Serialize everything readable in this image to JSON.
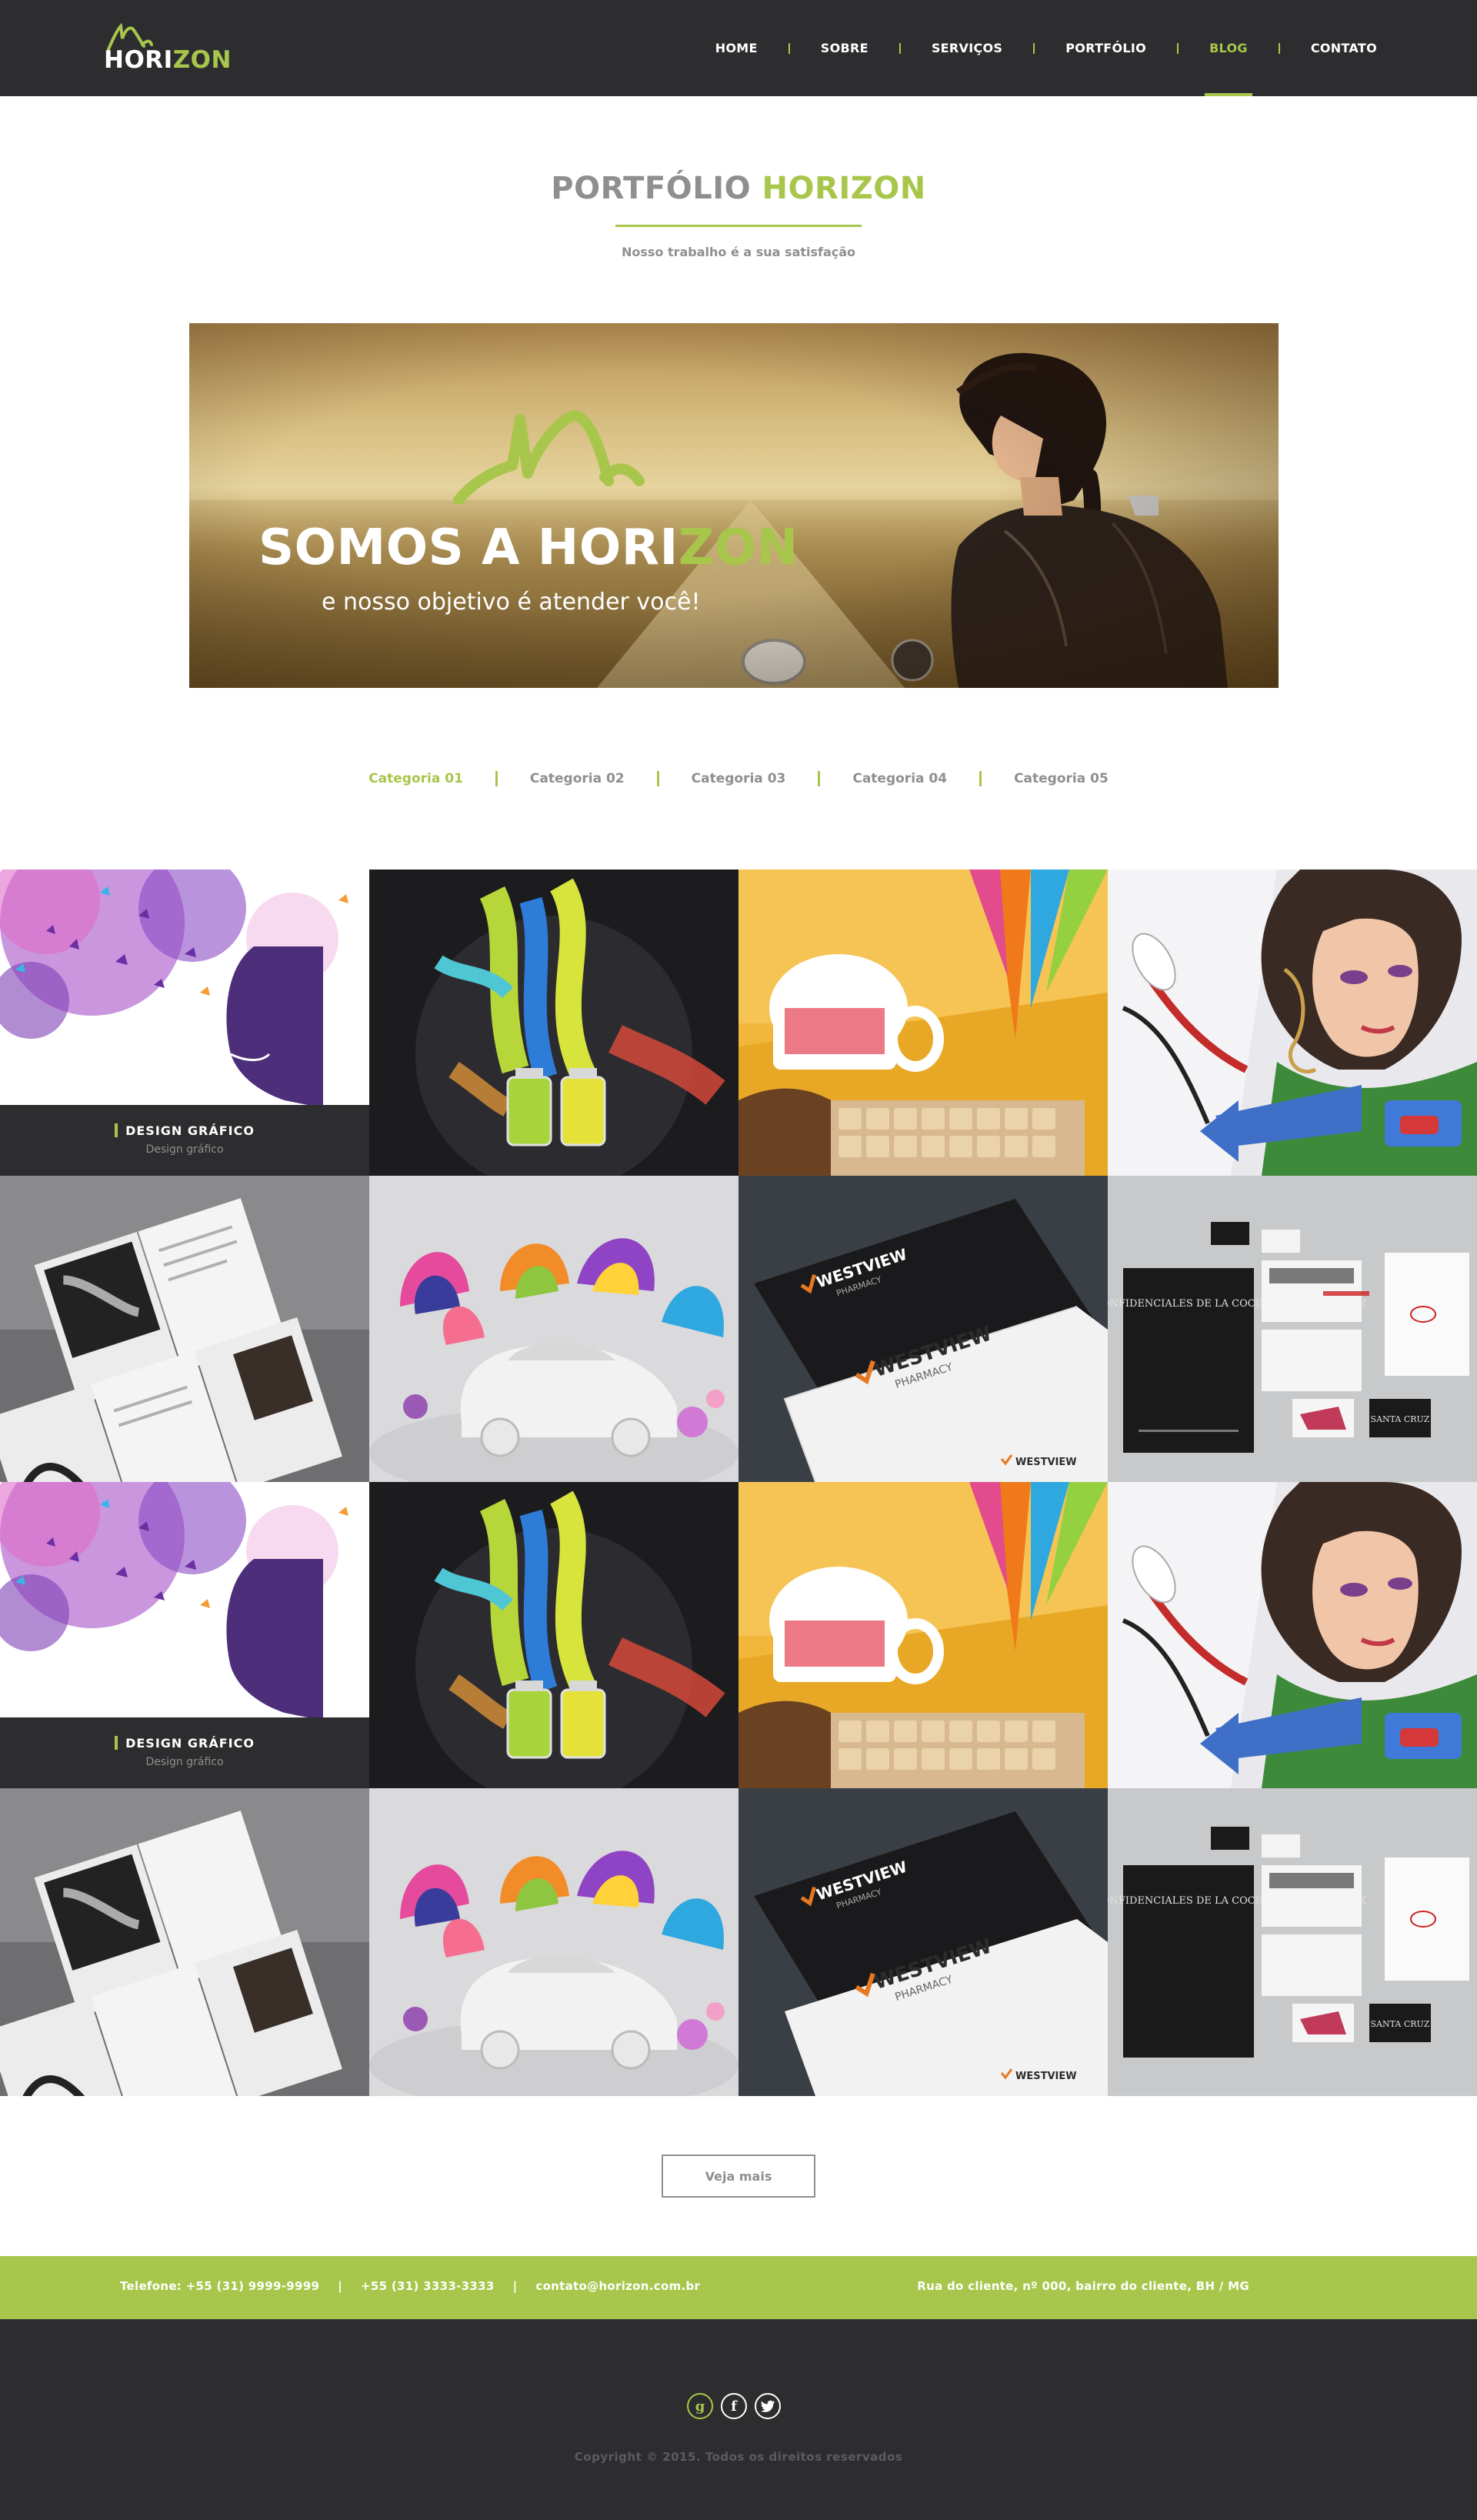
{
  "brand": {
    "logo_part1": "HORI",
    "logo_part2": "ZON"
  },
  "nav": {
    "items": [
      {
        "label": "HOME"
      },
      {
        "label": "SOBRE"
      },
      {
        "label": "SERVIÇOS"
      },
      {
        "label": "PORTFÓLIO"
      },
      {
        "label": "BLOG",
        "active": true
      },
      {
        "label": "CONTATO"
      }
    ]
  },
  "page": {
    "title_part1": "PORTFÓLIO",
    "title_part2": "HORIZON",
    "subtitle": "Nosso trabalho é a sua satisfação"
  },
  "hero": {
    "title_part1": "SOMOS A HORI",
    "title_part2": "ZON",
    "subtitle": "e nosso objetivo é atender você!"
  },
  "categories": [
    {
      "label": "Categoria 01",
      "active": true
    },
    {
      "label": "Categoria 02"
    },
    {
      "label": "Categoria 03"
    },
    {
      "label": "Categoria 04"
    },
    {
      "label": "Categoria 05"
    }
  ],
  "portfolio": {
    "overlay_title": "DESIGN GRÁFICO",
    "overlay_subtitle": "Design gráfico",
    "westview_1": "WESTVIEW",
    "westview_2": "PHARMACY",
    "documents_text": "DOCUMENTOS CONFIDENCIALES DE LA COCINA DE SANTA CRUZ",
    "santa_cruz": "SANTA CRUZ"
  },
  "more_button": "Veja mais",
  "contact": {
    "phone1": "Telefone: +55 (31) 9999-9999",
    "phone2": "+55 (31) 3333-3333",
    "email": "contato@horizon.com.br",
    "separator": "|",
    "address": "Rua do cliente, nº 000, bairro do cliente, BH / MG"
  },
  "social": [
    {
      "icon": "google-plus-icon",
      "glyph": "g"
    },
    {
      "icon": "facebook-icon",
      "glyph": "f"
    },
    {
      "icon": "twitter-icon",
      "glyph": "t"
    }
  ],
  "copyright": "Copyright © 2015. Todos os direitos reservados",
  "colors": {
    "accent": "#a8c64b",
    "dark": "#2d2d30",
    "grey": "#8f8f8f"
  }
}
